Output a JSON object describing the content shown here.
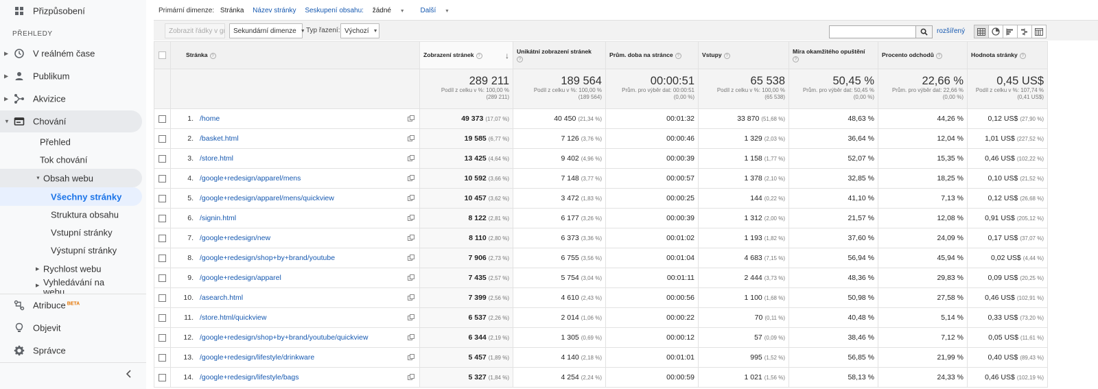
{
  "sidebar": {
    "customize": "Přizpůsobení",
    "reports_header": "PŘEHLEDY",
    "items": [
      {
        "label": "V reálném čase",
        "icon": "clock-icon"
      },
      {
        "label": "Publikum",
        "icon": "person-icon"
      },
      {
        "label": "Akvizice",
        "icon": "acquisition-icon"
      },
      {
        "label": "Chování",
        "icon": "behavior-icon"
      }
    ],
    "behavior_sub": {
      "overview": "Přehled",
      "flow": "Tok chování",
      "site_content": "Obsah webu",
      "all_pages": "Všechny stránky",
      "content_drilldown": "Struktura obsahu",
      "landing_pages": "Vstupní stránky",
      "exit_pages": "Výstupní stránky",
      "site_speed": "Rychlost webu",
      "site_search": "Vyhledávání na webu"
    },
    "attribution": "Atribuce",
    "attribution_badge": "BETA",
    "discover": "Objevit",
    "admin": "Správce"
  },
  "dimension_bar": {
    "primary_label": "Primární dimenze:",
    "current": "Stránka",
    "page_title": "Název stránky",
    "grouping_label": "Seskupení obsahu:",
    "grouping_value": "žádné",
    "more": "Další"
  },
  "toolbar": {
    "plot_rows": "Zobrazit řádky v grafu",
    "secondary_dimension": "Sekundární dimenze",
    "sort_type_label": "Typ řazení:",
    "sort_type_value": "Výchozí",
    "advanced": "rozšířený"
  },
  "columns": {
    "page": "Stránka",
    "pageviews": "Zobrazení stránek",
    "unique_pageviews": "Unikátní zobrazení stránek",
    "avg_time": "Prům. doba na stránce",
    "entrances": "Vstupy",
    "bounce_rate": "Míra okamžitého opuštění",
    "exit_pct": "Procento odchodů",
    "page_value": "Hodnota stránky"
  },
  "totals": {
    "pageviews": {
      "value": "289 211",
      "l1": "Podíl z celku v %: 100,00 %",
      "l2": "(289 211)"
    },
    "unique_pageviews": {
      "value": "189 564",
      "l1": "Podíl z celku v %: 100,00 %",
      "l2": "(189 564)"
    },
    "avg_time": {
      "value": "00:00:51",
      "l1": "Prům. pro výběr dat: 00:00:51",
      "l2": "(0,00 %)"
    },
    "entrances": {
      "value": "65 538",
      "l1": "Podíl z celku v %: 100,00 %",
      "l2": "(65 538)"
    },
    "bounce_rate": {
      "value": "50,45 %",
      "l1": "Prům. pro výběr dat: 50,45 %",
      "l2": "(0,00 %)"
    },
    "exit_pct": {
      "value": "22,66 %",
      "l1": "Prům. pro výběr dat: 22,66 %",
      "l2": "(0,00 %)"
    },
    "page_value": {
      "value": "0,45 US$",
      "l1": "Podíl z celku v %: 107,74 %",
      "l2": "(0,41 US$)"
    }
  },
  "rows": [
    {
      "idx": "1.",
      "page": "/home",
      "pv": "49 373",
      "pv_p": "(17,07 %)",
      "upv": "40 450",
      "upv_p": "(21,34 %)",
      "time": "00:01:32",
      "ent": "33 870",
      "ent_p": "(51,68 %)",
      "br": "48,63 %",
      "exit": "44,26 %",
      "val": "0,12 US$",
      "val_p": "(27,90 %)"
    },
    {
      "idx": "2.",
      "page": "/basket.html",
      "pv": "19 585",
      "pv_p": "(6,77 %)",
      "upv": "7 126",
      "upv_p": "(3,76 %)",
      "time": "00:00:46",
      "ent": "1 329",
      "ent_p": "(2,03 %)",
      "br": "36,64 %",
      "exit": "12,04 %",
      "val": "1,01 US$",
      "val_p": "(227,52 %)"
    },
    {
      "idx": "3.",
      "page": "/store.html",
      "pv": "13 425",
      "pv_p": "(4,64 %)",
      "upv": "9 402",
      "upv_p": "(4,96 %)",
      "time": "00:00:39",
      "ent": "1 158",
      "ent_p": "(1,77 %)",
      "br": "52,07 %",
      "exit": "15,35 %",
      "val": "0,46 US$",
      "val_p": "(102,22 %)"
    },
    {
      "idx": "4.",
      "page": "/google+redesign/apparel/mens",
      "pv": "10 592",
      "pv_p": "(3,66 %)",
      "upv": "7 148",
      "upv_p": "(3,77 %)",
      "time": "00:00:57",
      "ent": "1 378",
      "ent_p": "(2,10 %)",
      "br": "32,85 %",
      "exit": "18,25 %",
      "val": "0,10 US$",
      "val_p": "(21,52 %)"
    },
    {
      "idx": "5.",
      "page": "/google+redesign/apparel/mens/quickview",
      "pv": "10 457",
      "pv_p": "(3,62 %)",
      "upv": "3 472",
      "upv_p": "(1,83 %)",
      "time": "00:00:25",
      "ent": "144",
      "ent_p": "(0,22 %)",
      "br": "41,10 %",
      "exit": "7,13 %",
      "val": "0,12 US$",
      "val_p": "(26,68 %)"
    },
    {
      "idx": "6.",
      "page": "/signin.html",
      "pv": "8 122",
      "pv_p": "(2,81 %)",
      "upv": "6 177",
      "upv_p": "(3,26 %)",
      "time": "00:00:39",
      "ent": "1 312",
      "ent_p": "(2,00 %)",
      "br": "21,57 %",
      "exit": "12,08 %",
      "val": "0,91 US$",
      "val_p": "(205,12 %)"
    },
    {
      "idx": "7.",
      "page": "/google+redesign/new",
      "pv": "8 110",
      "pv_p": "(2,80 %)",
      "upv": "6 373",
      "upv_p": "(3,36 %)",
      "time": "00:01:02",
      "ent": "1 193",
      "ent_p": "(1,82 %)",
      "br": "37,60 %",
      "exit": "24,09 %",
      "val": "0,17 US$",
      "val_p": "(37,07 %)"
    },
    {
      "idx": "8.",
      "page": "/google+redesign/shop+by+brand/youtube",
      "pv": "7 906",
      "pv_p": "(2,73 %)",
      "upv": "6 755",
      "upv_p": "(3,56 %)",
      "time": "00:01:04",
      "ent": "4 683",
      "ent_p": "(7,15 %)",
      "br": "56,94 %",
      "exit": "45,94 %",
      "val": "0,02 US$",
      "val_p": "(4,44 %)"
    },
    {
      "idx": "9.",
      "page": "/google+redesign/apparel",
      "pv": "7 435",
      "pv_p": "(2,57 %)",
      "upv": "5 754",
      "upv_p": "(3,04 %)",
      "time": "00:01:11",
      "ent": "2 444",
      "ent_p": "(3,73 %)",
      "br": "48,36 %",
      "exit": "29,83 %",
      "val": "0,09 US$",
      "val_p": "(20,25 %)"
    },
    {
      "idx": "10.",
      "page": "/asearch.html",
      "pv": "7 399",
      "pv_p": "(2,56 %)",
      "upv": "4 610",
      "upv_p": "(2,43 %)",
      "time": "00:00:56",
      "ent": "1 100",
      "ent_p": "(1,68 %)",
      "br": "50,98 %",
      "exit": "27,58 %",
      "val": "0,46 US$",
      "val_p": "(102,91 %)"
    },
    {
      "idx": "11.",
      "page": "/store.html/quickview",
      "pv": "6 537",
      "pv_p": "(2,26 %)",
      "upv": "2 014",
      "upv_p": "(1,06 %)",
      "time": "00:00:22",
      "ent": "70",
      "ent_p": "(0,11 %)",
      "br": "40,48 %",
      "exit": "5,14 %",
      "val": "0,33 US$",
      "val_p": "(73,20 %)"
    },
    {
      "idx": "12.",
      "page": "/google+redesign/shop+by+brand/youtube/quickview",
      "pv": "6 344",
      "pv_p": "(2,19 %)",
      "upv": "1 305",
      "upv_p": "(0,69 %)",
      "time": "00:00:12",
      "ent": "57",
      "ent_p": "(0,09 %)",
      "br": "38,46 %",
      "exit": "7,12 %",
      "val": "0,05 US$",
      "val_p": "(11,61 %)"
    },
    {
      "idx": "13.",
      "page": "/google+redesign/lifestyle/drinkware",
      "pv": "5 457",
      "pv_p": "(1,89 %)",
      "upv": "4 140",
      "upv_p": "(2,18 %)",
      "time": "00:01:01",
      "ent": "995",
      "ent_p": "(1,52 %)",
      "br": "56,85 %",
      "exit": "21,99 %",
      "val": "0,40 US$",
      "val_p": "(89,43 %)"
    },
    {
      "idx": "14.",
      "page": "/google+redesign/lifestyle/bags",
      "pv": "5 327",
      "pv_p": "(1,84 %)",
      "upv": "4 254",
      "upv_p": "(2,24 %)",
      "time": "00:00:59",
      "ent": "1 021",
      "ent_p": "(1,56 %)",
      "br": "58,13 %",
      "exit": "24,33 %",
      "val": "0,46 US$",
      "val_p": "(102,19 %)"
    }
  ]
}
